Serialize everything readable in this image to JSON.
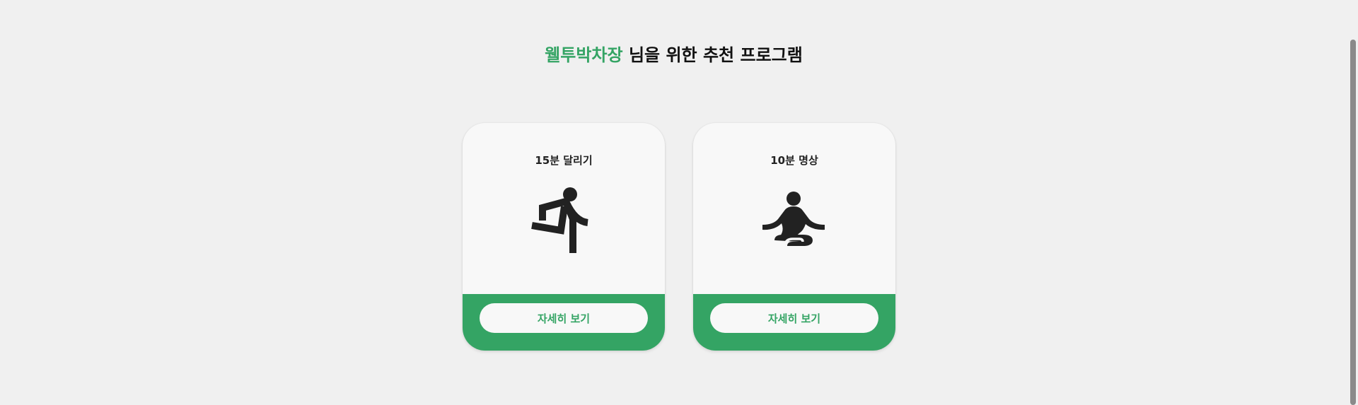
{
  "header": {
    "user_name": "웰투박차장",
    "title_suffix": "님을 위한 추천 프로그램"
  },
  "programs": [
    {
      "title": "15분 달리기",
      "icon": "running-person-icon",
      "button_label": "자세히 보기"
    },
    {
      "title": "10분 명상",
      "icon": "meditation-person-icon",
      "button_label": "자세히 보기"
    }
  ],
  "colors": {
    "accent": "#34a464",
    "background": "#f0f0f0",
    "card": "#f8f8f8",
    "icon": "#222222"
  }
}
